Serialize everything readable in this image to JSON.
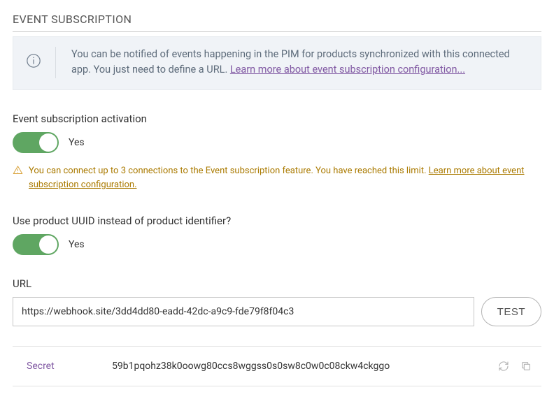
{
  "title": "EVENT SUBSCRIPTION",
  "info": {
    "text_part1": "You can be notified of events happening in the PIM for products synchronized with this connected app. You just need to define a URL. ",
    "link_text": "Learn more about event subscription configuration..."
  },
  "activation": {
    "label": "Event subscription activation",
    "state_label": "Yes"
  },
  "warning": {
    "text_part1": "You can connect up to 3 connections to the Event subscription feature. You have reached this limit. ",
    "link_text": "Learn more about event subscription configuration."
  },
  "uuid_toggle": {
    "label": "Use product UUID instead of product identifier?",
    "state_label": "Yes"
  },
  "url_field": {
    "label": "URL",
    "value": "https://webhook.site/3dd4dd80-eadd-42dc-a9c9-fde79f8f04c3",
    "test_btn": "TEST"
  },
  "secret": {
    "label": "Secret",
    "value": "59b1pqohz38k0oowg80ccs8wggss0s0sw8c0w0c08ckw4ckggo"
  }
}
